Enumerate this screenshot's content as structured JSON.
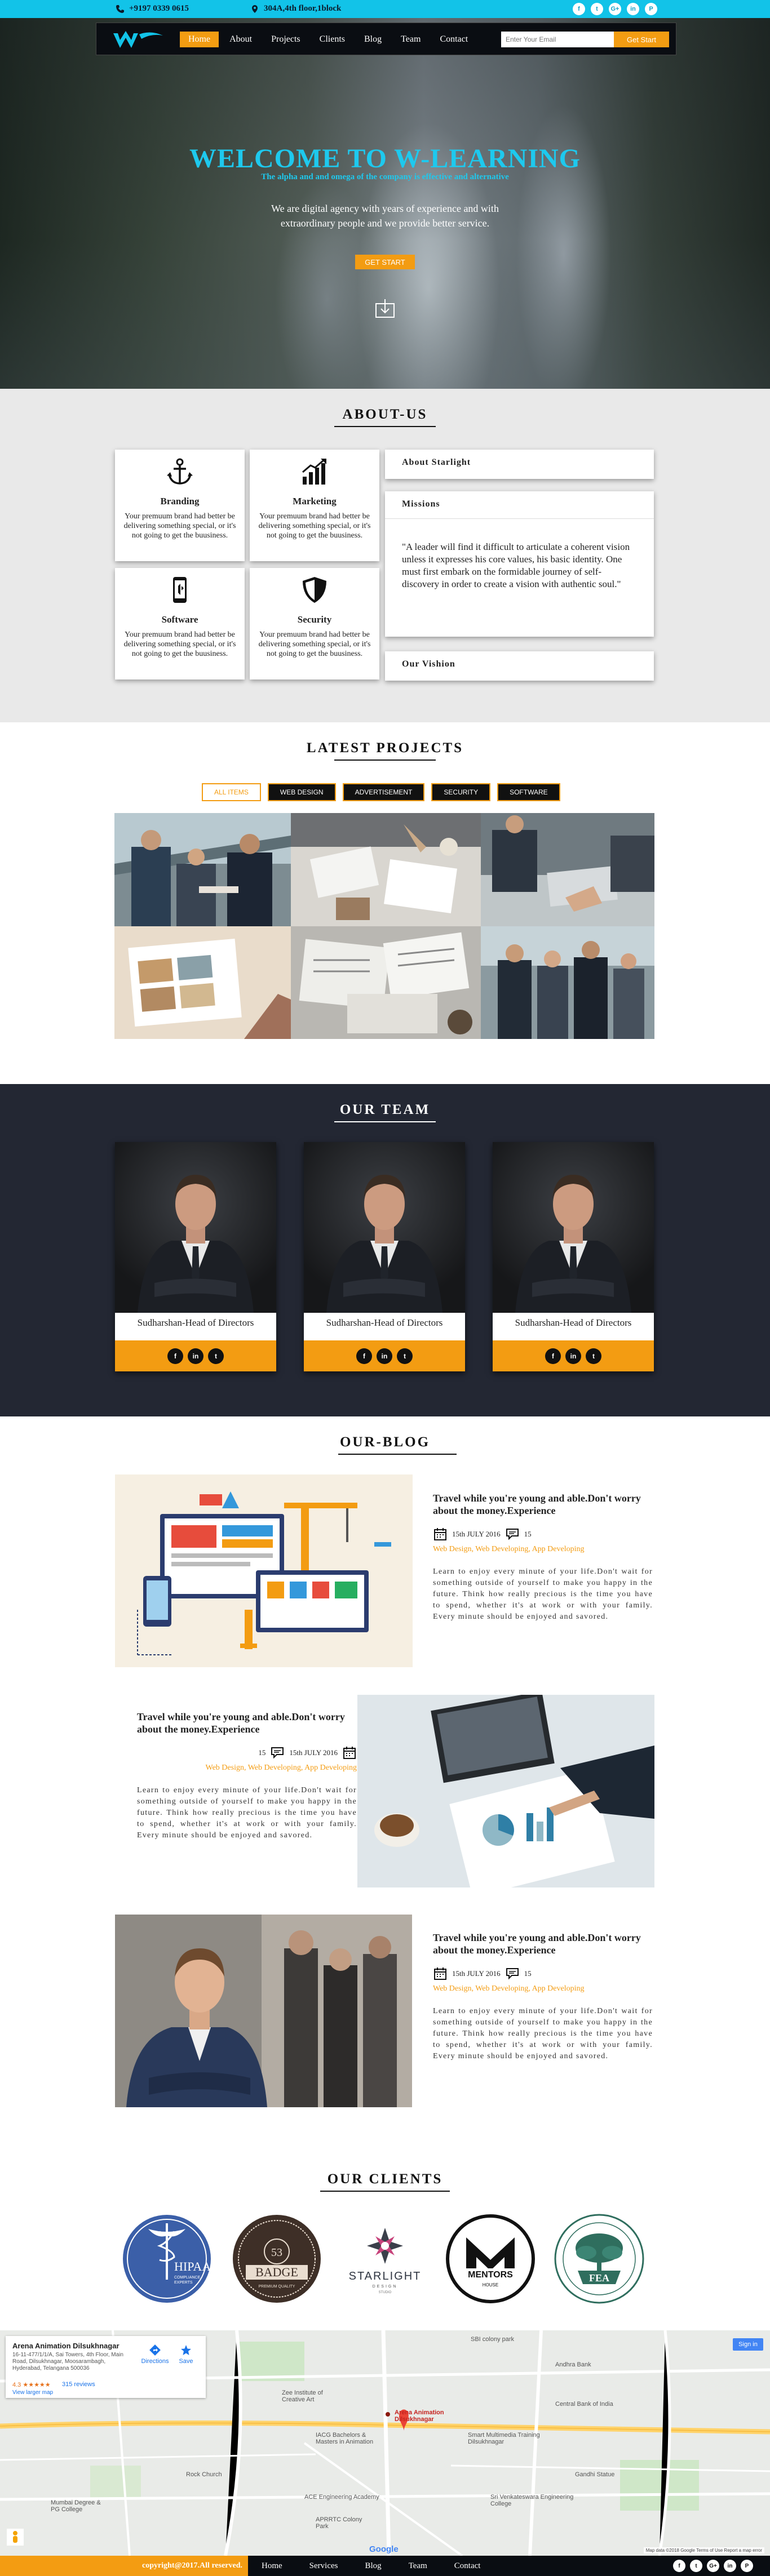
{
  "topbar": {
    "phone": "+9197 0339 0615",
    "address": "304A,4th floor,1block",
    "social": [
      "f",
      "t",
      "G+",
      "in",
      "P"
    ]
  },
  "nav": {
    "items": [
      "Home",
      "About",
      "Projects",
      "Clients",
      "Blog",
      "Team",
      "Contact"
    ],
    "active": "Home",
    "email_placeholder": "Enter Your Email",
    "get_start": "Get Start"
  },
  "hero": {
    "title": "WELCOME TO W-LEARNING",
    "subtitle": "The alpha and and omega of the company is effective and alternative",
    "description": "We are digital agency with years of experience and with extraordinary people and we provide better service.",
    "cta": "GET START"
  },
  "about": {
    "heading": "ABOUT-US",
    "cards": [
      {
        "title": "Branding",
        "icon": "anchor-icon",
        "text": "Your premuum brand had better be delivering something special, or it's not going to get the buusiness."
      },
      {
        "title": "Marketing",
        "icon": "chart-icon",
        "text": "Your premuum brand had better be delivering something special, or it's not going to get the buusiness."
      },
      {
        "title": "Software",
        "icon": "phone-icon",
        "text": "Your premuum brand had better be delivering something special, or it's not going to get the buusiness."
      },
      {
        "title": "Security",
        "icon": "shield-icon",
        "text": "Your premuum brand had better be delivering something special, or it's not going to get the buusiness."
      }
    ],
    "panels": {
      "about_starlight": "About Starlight",
      "missions": "Missions",
      "quote": "\"A leader will find it difficult to articulate a coherent vision unless it expresses his core values, his basic identity. One must first embark on the formidable journey of self-discovery in order to create a vision with authentic soul.\"",
      "vision": "Our Vishion"
    }
  },
  "projects": {
    "heading": "LATEST PROJECTS",
    "tabs": [
      "ALL ITEMS",
      "WEB DESIGN",
      "ADVERTISEMENT",
      "SECURITY",
      "SOFTWARE"
    ],
    "active_tab": "ALL ITEMS"
  },
  "team": {
    "heading": "OUR TEAM",
    "members": [
      {
        "name": "Sudharshan-Head of Directors"
      },
      {
        "name": "Sudharshan-Head of Directors"
      },
      {
        "name": "Sudharshan-Head of Directors"
      }
    ],
    "social": [
      "f",
      "in",
      "t"
    ]
  },
  "blog": {
    "heading": "OUR-BLOG",
    "posts": [
      {
        "title": "Travel while you're young and able.Don't worry about the money.Experience",
        "date": "15th JULY 2016",
        "comments": "15",
        "categories": "Web Design, Web Developing, App Developing",
        "body": "Learn to enjoy every minute of your life.Don't wait for something outside of yourself to make you happy in the future. Think how really precious is the time you have to spend, whether it's at work or with your family. Every minute should be enjoyed and savored."
      },
      {
        "title": "Travel while you're young and able.Don't worry about the money.Experience",
        "date": "15th JULY 2016",
        "comments": "15",
        "categories": "Web Design, Web Developing, App Developing",
        "body": "Learn to enjoy every minute of your life.Don't wait for something outside of yourself to make you happy in the future. Think how really precious is the time you have to spend, whether it's at work or with your family. Every minute should be enjoyed and savored."
      },
      {
        "title": "Travel while you're young and able.Don't worry about the money.Experience",
        "date": "15th JULY 2016",
        "comments": "15",
        "categories": "Web Design, Web Developing, App Developing",
        "body": "Learn to enjoy every minute of your life.Don't wait for something outside of yourself to make you happy in the future. Think how really precious is the time you have to spend, whether it's at work or with your family. Every minute should be enjoyed and savored."
      }
    ]
  },
  "clients": {
    "heading": "OUR CLIENTS",
    "logos": [
      {
        "name": "HIPAA",
        "line2": "COMPLIANCE",
        "line3": "EXPERTS"
      },
      {
        "name": "BADGE",
        "line2": "53",
        "line3": "PREMIUM QUALITY"
      },
      {
        "name": "STARLIGHT",
        "line2": "DESIGN",
        "line3": "STUDIO"
      },
      {
        "name": "MENTORS",
        "line2": "HOUSE",
        "line3": ""
      },
      {
        "name": "FEA",
        "line2": "",
        "line3": ""
      }
    ]
  },
  "map": {
    "place_name": "Arena Animation Dilsukhnagar",
    "address": "16-11-477/1/1/A, Sai Towers, 4th Floor, Main Road, Dilsukhnagar, Moosarambagh, Hyderabad, Telangana 500036",
    "rating": "4.3 ★★★★★",
    "reviews": "315 reviews",
    "view_larger": "View larger map",
    "directions": "Directions",
    "save": "Save",
    "sign_in": "Sign in",
    "marker_label": "Arena Animation Dilsukhnagar",
    "labels": [
      "Andhra Bank",
      "Central Bank of India",
      "SBI colony park",
      "Zee Institute of Creative Art",
      "Smart Multimedia Training Dilsukhnagar",
      "Sri Venkateswara Engineering College",
      "Gandhi Statue",
      "APRRTC Colony Park",
      "ACE Engineering Academy",
      "Mumbai Degree & PG College",
      "Rock Church",
      "IACG Bachelors & Masters in Animation"
    ],
    "google": "Google",
    "footer_text": "Map data ©2018 Google   Terms of Use   Report a map error"
  },
  "footer": {
    "copyright": "copyright@2017.All reserved.",
    "menu": [
      "Home",
      "Services",
      "Blog",
      "Team",
      "Contact"
    ],
    "social": [
      "f",
      "t",
      "G+",
      "in",
      "P"
    ]
  },
  "colors": {
    "accent": "#f39c12",
    "cyan": "#12c3e8",
    "dark": "#0a0d12",
    "team_bg": "#232733"
  }
}
